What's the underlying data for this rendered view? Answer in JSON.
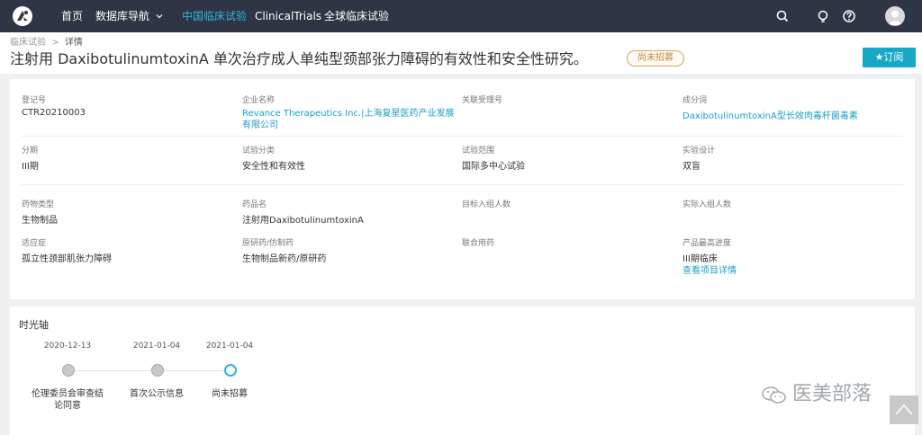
{
  "nav": {
    "items": [
      "首页",
      "数据库导航",
      "中国临床试验",
      "ClinicalTrials",
      "全球临床试验"
    ],
    "active_index": 2
  },
  "header": {
    "breadcrumb": [
      "临床试验",
      "详情"
    ],
    "breadcrumb_separator": ">",
    "title": "注射用 DaxibotulinumtoxinA 单次治疗成人单纯型颈部张力障碍的有效性和安全性研究。",
    "status": "尚未招募",
    "subscribe_label": "★订阅"
  },
  "fields": [
    {
      "label": "登记号",
      "value": "CTR20210003",
      "link": false
    },
    {
      "label": "企业名称",
      "value": "Revance Therapeutics Inc.|上海复星医药产业发展有限公司",
      "link": true
    },
    {
      "label": "关联受理号",
      "value": "",
      "link": false
    },
    {
      "label": "成分词",
      "value": "DaxibotulinumtoxinA型长效肉毒杆菌毒素",
      "link": true
    },
    {
      "label": "分期",
      "value": "III期",
      "link": false
    },
    {
      "label": "试验分类",
      "value": "安全性和有效性",
      "link": false
    },
    {
      "label": "试验范围",
      "value": "国际多中心试验",
      "link": false
    },
    {
      "label": "实验设计",
      "value": "双盲",
      "link": false
    },
    {
      "label": "药物类型",
      "value": "生物制品",
      "link": false
    },
    {
      "label": "药品名",
      "value": "注射用DaxibotulinumtoxinA",
      "link": false
    },
    {
      "label": "目标入组人数",
      "value": "",
      "link": false
    },
    {
      "label": "实际入组人数",
      "value": "",
      "link": false
    },
    {
      "label": "适应症",
      "value": "孤立性颈部肌张力障碍",
      "link": false
    },
    {
      "label": "原研药/仿制药",
      "value": "生物制品新药/原研药",
      "link": false
    },
    {
      "label": "联合用药",
      "value": "",
      "link": false
    },
    {
      "label": "产品最高进度",
      "value": "III期临床",
      "link": false,
      "extra_link": "查看项目详情"
    }
  ],
  "timeline": {
    "title": "时光轴",
    "events": [
      {
        "date": "2020-12-13",
        "label": "伦理委员会审查结论同意",
        "current": false
      },
      {
        "date": "2021-01-04",
        "label": "首次公示信息",
        "current": false
      },
      {
        "date": "2021-01-04",
        "label": "尚未招募",
        "current": true
      }
    ]
  },
  "watermark": "医美部落",
  "colors": {
    "topbar": "#2f3545",
    "accent": "#17a8c8",
    "link": "#1a9fc6",
    "status_badge": "#c9853e"
  },
  "icons": [
    "logo-icon",
    "chevron-down-icon",
    "search-icon",
    "bulb-icon",
    "help-icon",
    "user-avatar-icon",
    "wechat-icon",
    "arrow-up-icon"
  ]
}
